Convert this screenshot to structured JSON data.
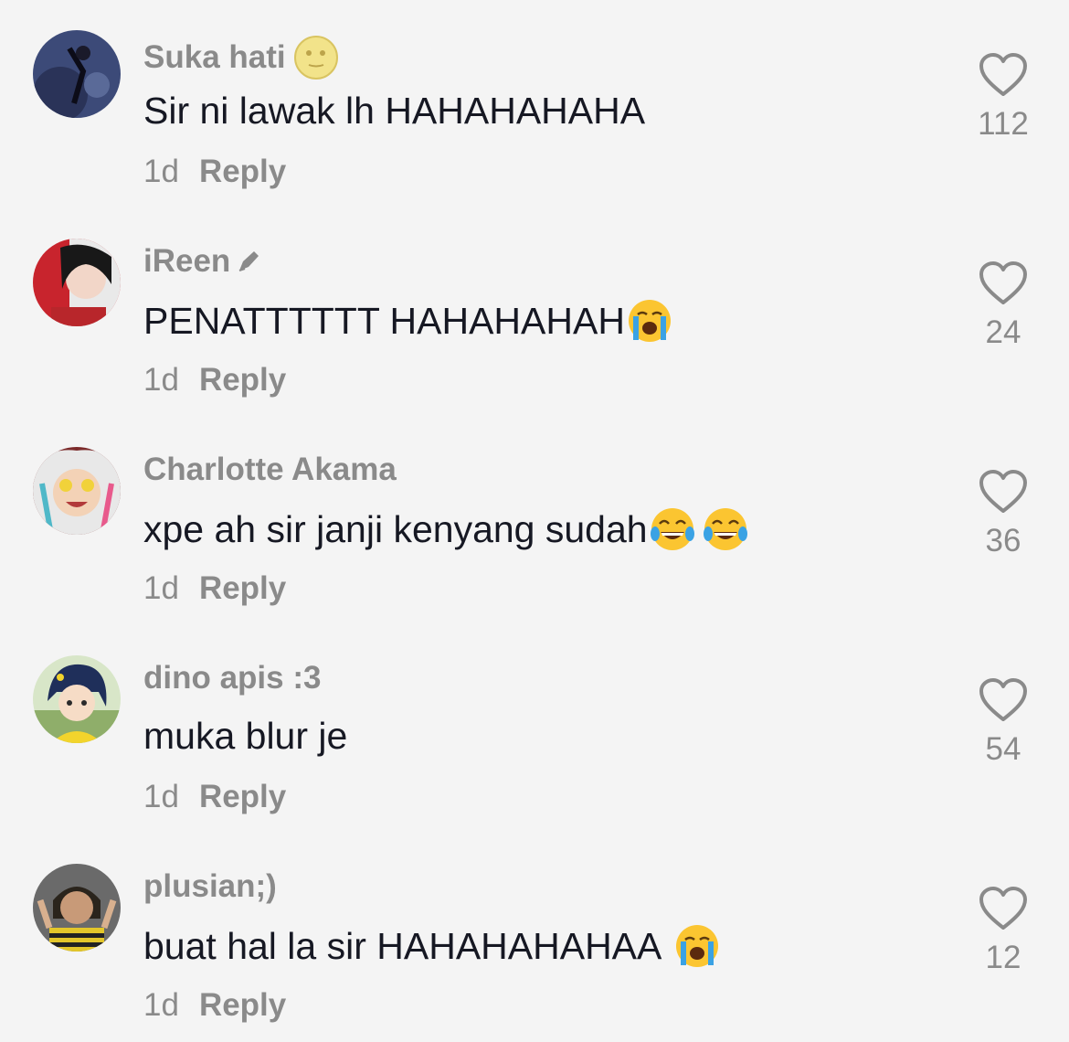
{
  "comments": [
    {
      "username": "Suka hati",
      "username_emoji": "moon-face-icon",
      "text": "Sir ni lawak lh HAHAHAHAHA",
      "emojis": [],
      "time": "1d",
      "reply_label": "Reply",
      "likes": "112"
    },
    {
      "username": "iReen",
      "username_emoji": "pen-icon",
      "text": "PENATTTTTT HAHAHAHAH",
      "emojis": [
        "crying-face-icon"
      ],
      "time": "1d",
      "reply_label": "Reply",
      "likes": "24"
    },
    {
      "username": "Charlotte Akama",
      "username_emoji": "",
      "text": "xpe ah sir janji kenyang sudah",
      "emojis": [
        "tears-of-joy-icon",
        "tears-of-joy-icon"
      ],
      "time": "1d",
      "reply_label": "Reply",
      "likes": "36"
    },
    {
      "username": "dino apis :3",
      "username_emoji": "",
      "text": "muka blur je",
      "emojis": [],
      "time": "1d",
      "reply_label": "Reply",
      "likes": "54"
    },
    {
      "username": "plusian;)",
      "username_emoji": "",
      "text": "buat hal la sir HAHAHAHAHAA",
      "emojis": [
        "crying-face-icon"
      ],
      "time": "1d",
      "reply_label": "Reply",
      "likes": "12"
    }
  ],
  "colors": {
    "background": "#f4f4f4",
    "primary_text": "#161823",
    "secondary_text": "#8a8a8a"
  }
}
